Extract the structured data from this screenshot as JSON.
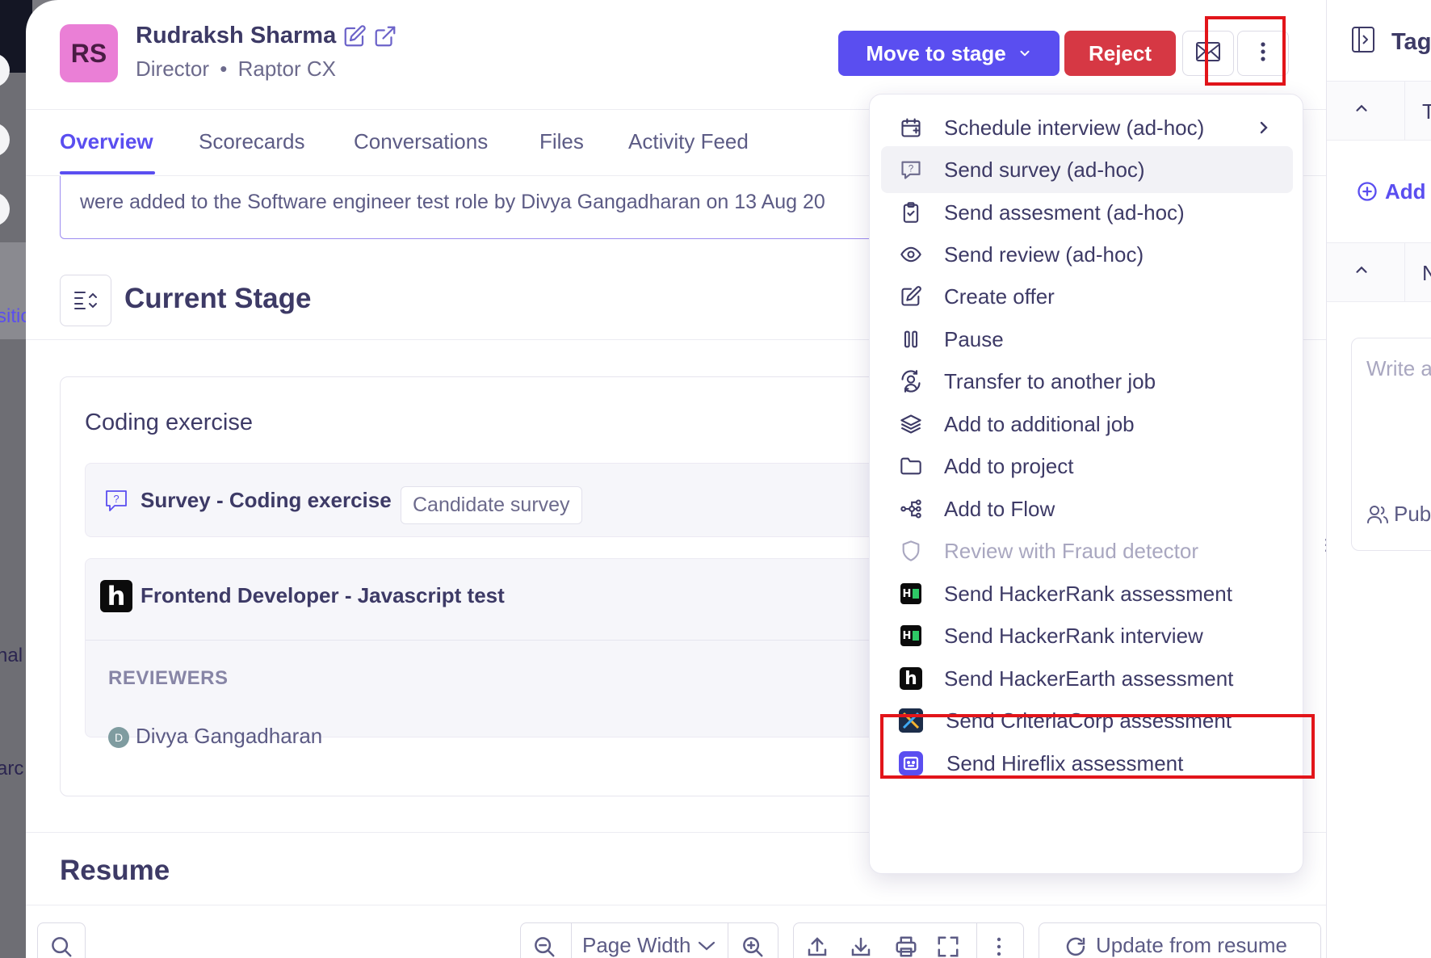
{
  "candidate": {
    "initials": "RS",
    "name": "Rudraksh Sharma",
    "title": "Director",
    "company": "Raptor CX"
  },
  "actions": {
    "move_to_stage": "Move to stage",
    "reject": "Reject"
  },
  "tabs": [
    {
      "label": "Overview",
      "active": true
    },
    {
      "label": "Scorecards",
      "active": false
    },
    {
      "label": "Conversations",
      "active": false
    },
    {
      "label": "Files",
      "active": false
    },
    {
      "label": "Activity Feed",
      "active": false
    }
  ],
  "notice_text": "were added to the Software engineer test role by Divya Gangadharan on 13 Aug 20",
  "current_stage": {
    "heading": "Current Stage",
    "stage_name": "Coding exercise",
    "survey": {
      "name": "Survey - Coding exercise",
      "tag": "Candidate survey"
    },
    "assessment": {
      "name": "Frontend Developer - Javascript test",
      "reviewers_label": "REVIEWERS",
      "reviewer_initial": "D",
      "reviewer_name": "Divya Gangadharan"
    }
  },
  "resume": {
    "heading": "Resume",
    "zoom_option": "Page Width",
    "update_label": "Update from resume"
  },
  "side_panel": {
    "title": "Tags",
    "row1_label": "T",
    "add_label": "Add",
    "row2_label": "N",
    "note_placeholder": "Write a",
    "visibility_label": "Pub"
  },
  "background_fragments": {
    "frag1": "sitic",
    "frag2": "nal",
    "frag3": "arc"
  },
  "menu": {
    "items": [
      {
        "label": "Schedule interview (ad-hoc)",
        "icon": "calendar-plus-icon",
        "submenu": true
      },
      {
        "label": "Send survey (ad-hoc)",
        "icon": "survey-icon",
        "hover": true
      },
      {
        "label": "Send assesment (ad-hoc)",
        "icon": "clipboard-check-icon"
      },
      {
        "label": "Send review (ad-hoc)",
        "icon": "eye-icon"
      },
      {
        "label": "Create offer",
        "icon": "edit-icon"
      },
      {
        "label": "Pause",
        "icon": "pause-icon"
      },
      {
        "label": "Transfer to another job",
        "icon": "transfer-icon"
      },
      {
        "label": "Add to additional job",
        "icon": "layers-icon"
      },
      {
        "label": "Add to project",
        "icon": "folder-icon"
      },
      {
        "label": "Add to Flow",
        "icon": "flow-icon"
      },
      {
        "label": "Review with Fraud detector",
        "icon": "shield-icon",
        "disabled": true
      },
      {
        "label": "Send HackerRank assessment",
        "icon": "hackerrank-logo-icon"
      },
      {
        "label": "Send HackerRank interview",
        "icon": "hackerrank-logo-icon"
      },
      {
        "label": "Send HackerEarth assessment",
        "icon": "hackerearth-logo-icon",
        "highlighted": true
      },
      {
        "label": "Send CriteriaCorp assessment",
        "icon": "criteriacorp-logo-icon"
      },
      {
        "label": "Send Hireflix assessment",
        "icon": "hireflix-logo-icon"
      }
    ]
  },
  "colors": {
    "primary": "#5a4ef0",
    "reject": "#d63844",
    "avatar": "#ea7fd6",
    "highlight_box": "#e2151a",
    "text": "#3d3a66"
  }
}
